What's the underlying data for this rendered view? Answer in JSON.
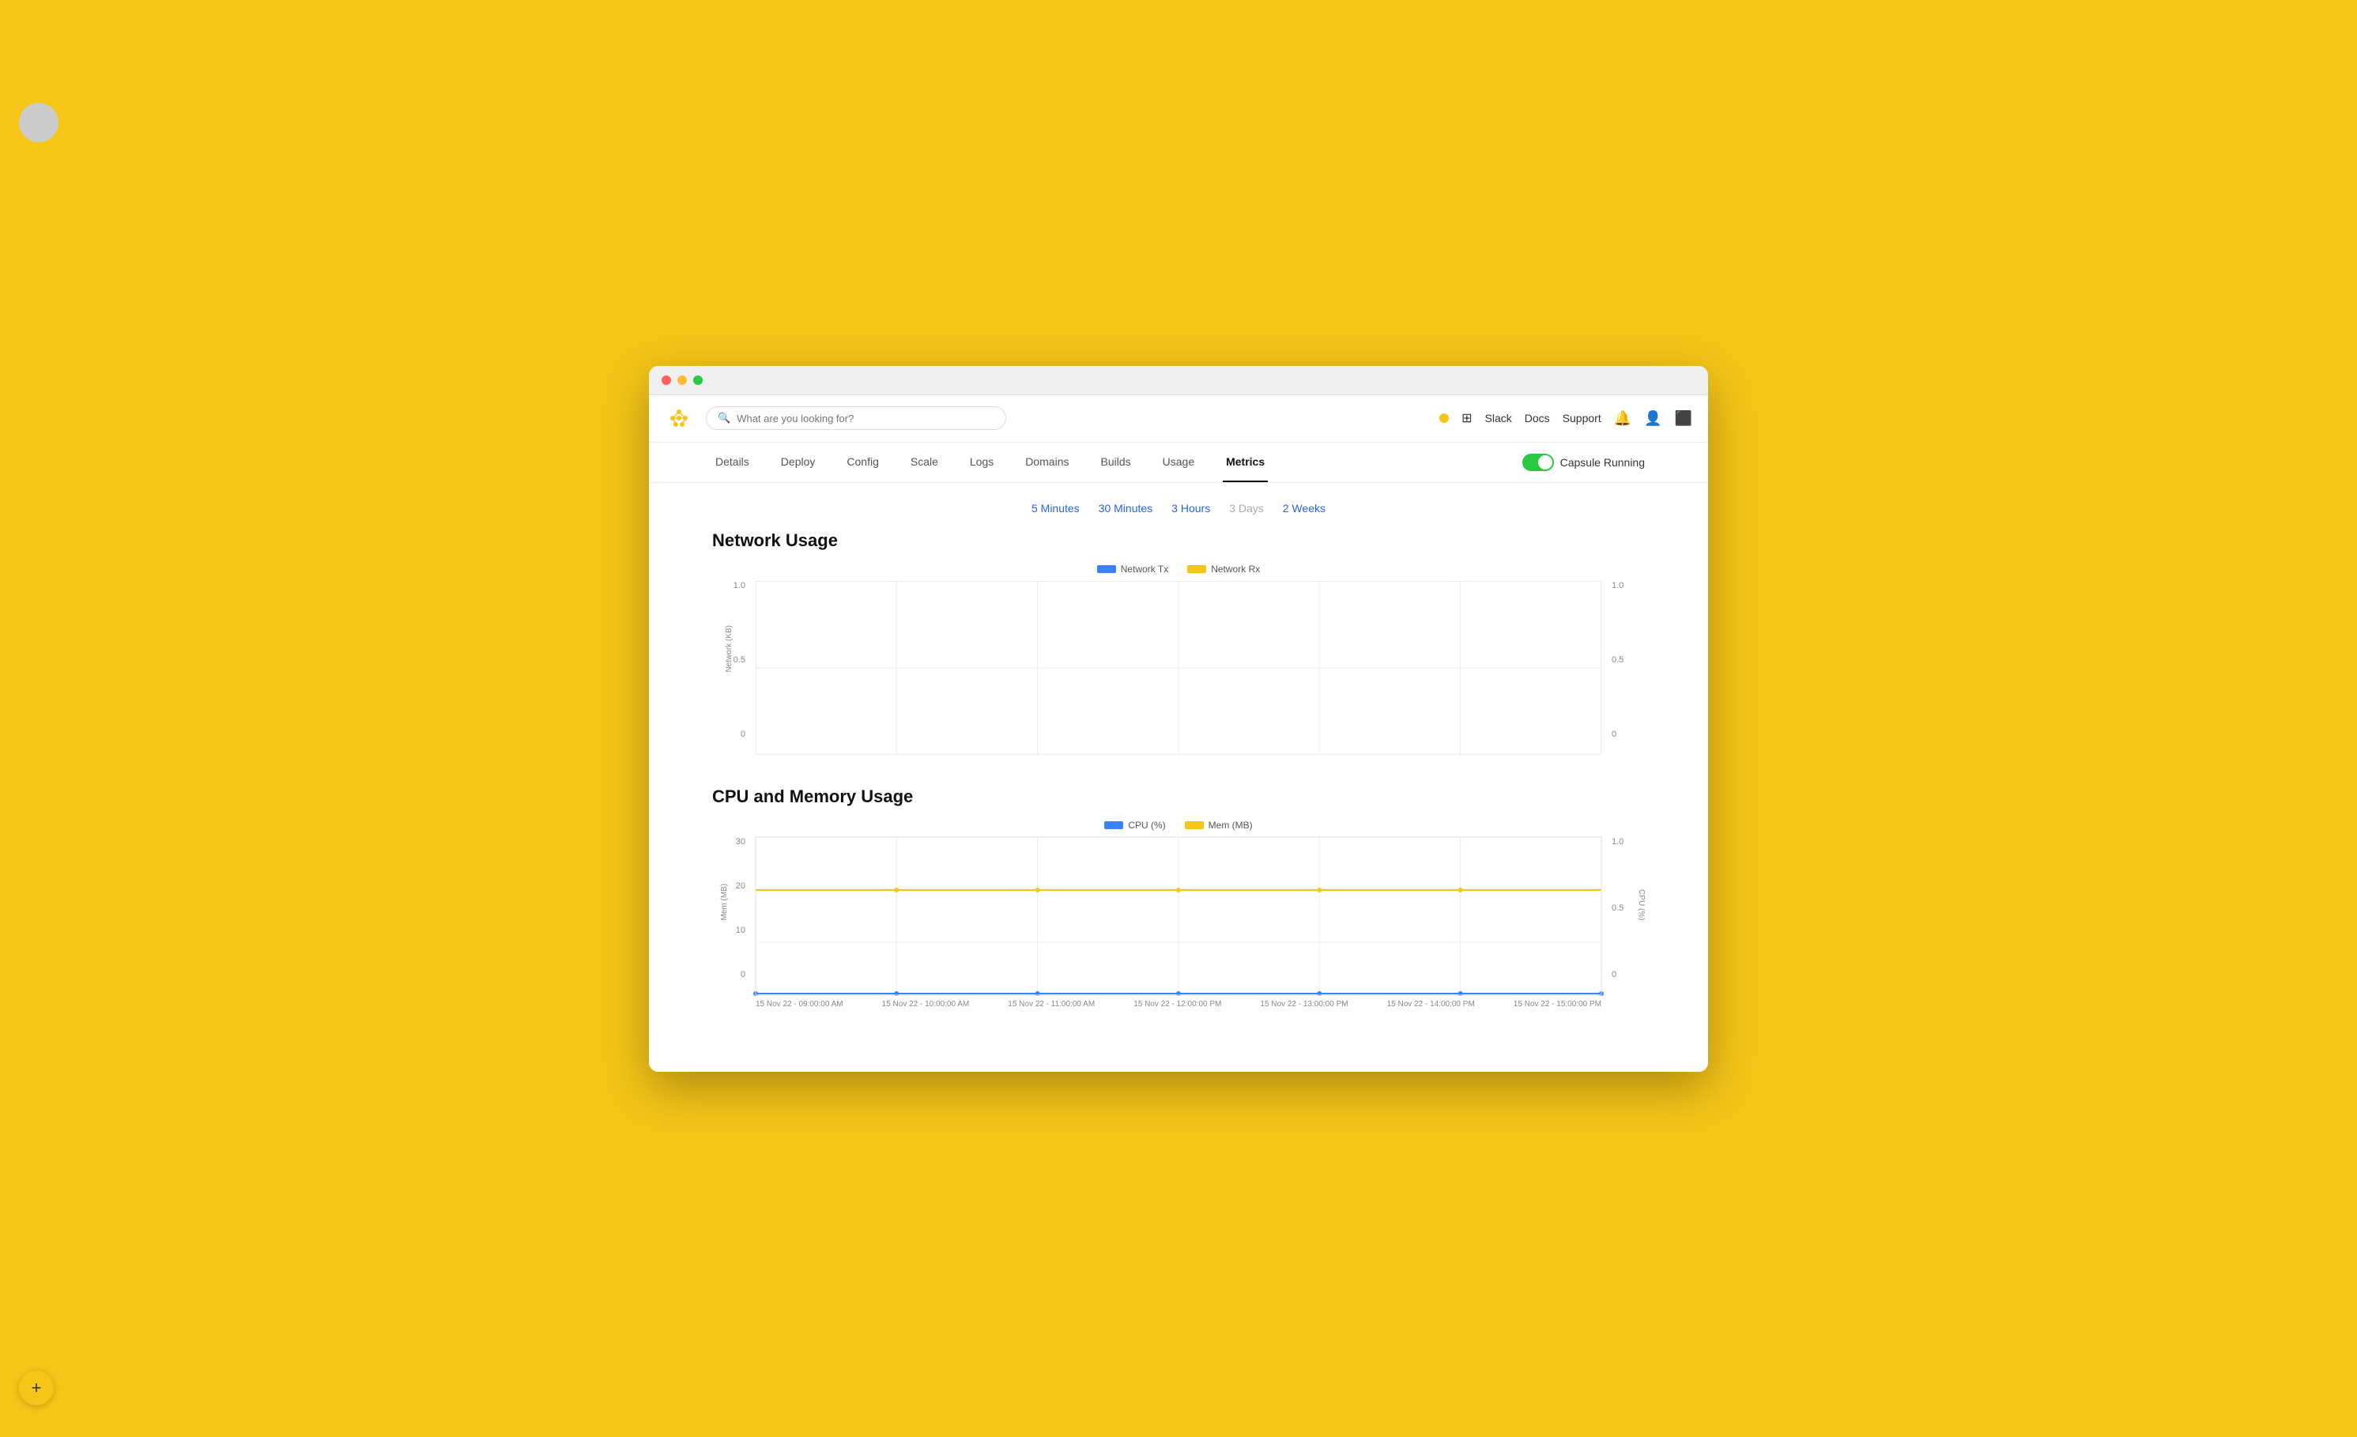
{
  "window": {
    "title": "Metrics"
  },
  "header": {
    "search_placeholder": "What are you looking for?",
    "slack_label": "Slack",
    "docs_label": "Docs",
    "support_label": "Support",
    "capsule_status": "Capsule Running"
  },
  "nav": {
    "tabs": [
      {
        "id": "details",
        "label": "Details",
        "active": false
      },
      {
        "id": "deploy",
        "label": "Deploy",
        "active": false
      },
      {
        "id": "config",
        "label": "Config",
        "active": false
      },
      {
        "id": "scale",
        "label": "Scale",
        "active": false
      },
      {
        "id": "logs",
        "label": "Logs",
        "active": false
      },
      {
        "id": "domains",
        "label": "Domains",
        "active": false
      },
      {
        "id": "builds",
        "label": "Builds",
        "active": false
      },
      {
        "id": "usage",
        "label": "Usage",
        "active": false
      },
      {
        "id": "metrics",
        "label": "Metrics",
        "active": true
      }
    ]
  },
  "time_filters": [
    {
      "id": "5min",
      "label": "5 Minutes",
      "active": true
    },
    {
      "id": "30min",
      "label": "30 Minutes",
      "active": true
    },
    {
      "id": "3hours",
      "label": "3 Hours",
      "active": true
    },
    {
      "id": "3days",
      "label": "3 Days",
      "active": false
    },
    {
      "id": "2weeks",
      "label": "2 Weeks",
      "active": true
    }
  ],
  "network_section": {
    "title": "Network Usage",
    "legend": [
      {
        "label": "Network Tx",
        "color": "blue"
      },
      {
        "label": "Network Rx",
        "color": "yellow"
      }
    ],
    "y_label": "Network (KB)",
    "y_min": "0",
    "y_mid": "0.5",
    "y_max": "1.0",
    "y_right_min": "0",
    "y_right_mid": "0.5",
    "y_right_max": "1.0"
  },
  "cpu_section": {
    "title": "CPU and Memory Usage",
    "legend": [
      {
        "label": "CPU (%)",
        "color": "blue"
      },
      {
        "label": "Mem (MB)",
        "color": "yellow"
      }
    ],
    "y_label": "Mem (MB)",
    "y_right_label": "CPU (%)",
    "y_values": [
      "0",
      "10",
      "20",
      "30"
    ],
    "y_right_values": [
      "0",
      "0.5",
      "1.0"
    ],
    "x_labels": [
      "15 Nov 22 - 09:00:00 AM",
      "15 Nov 22 - 10:00:00 AM",
      "15 Nov 22 - 11:00:00 AM",
      "15 Nov 22 - 12:00:00 PM",
      "15 Nov 22 - 13:00:00 PM",
      "15 Nov 22 - 14:00:00 PM",
      "15 Nov 22 - 15:00:00 PM"
    ]
  },
  "fab": {
    "label": "+"
  }
}
